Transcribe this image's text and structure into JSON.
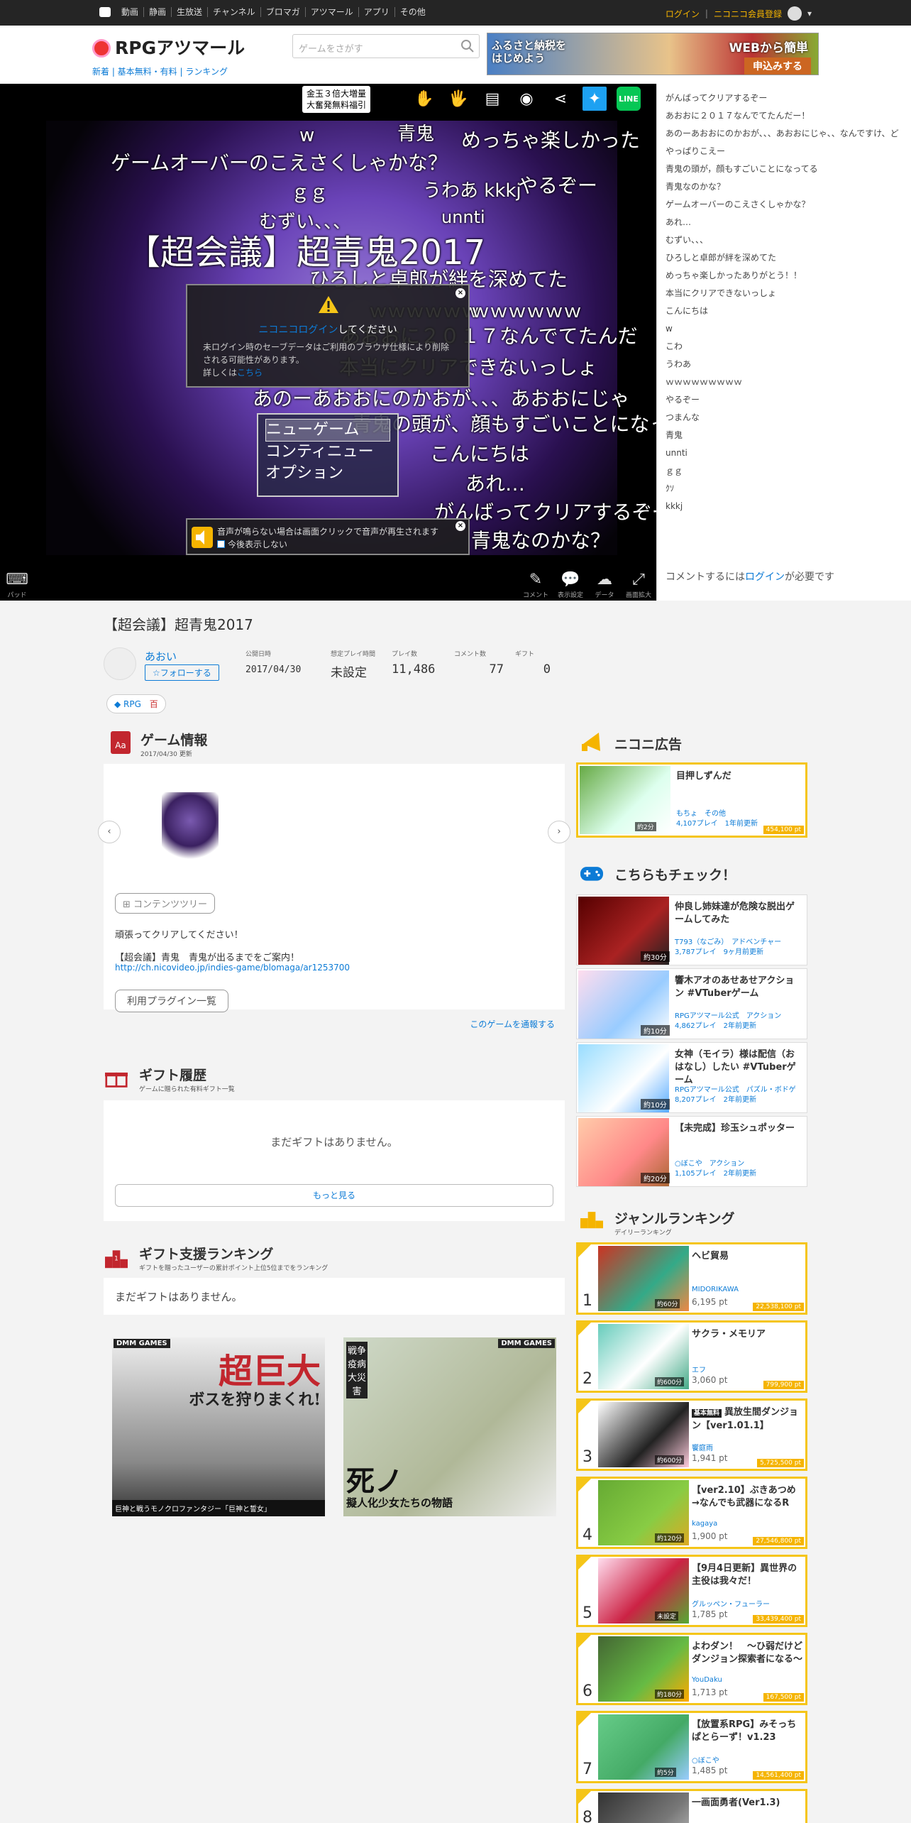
{
  "topbar": {
    "nav": [
      "動画",
      "静画",
      "生放送",
      "チャンネル",
      "ブロマガ",
      "アツマール",
      "アプリ",
      "その他"
    ],
    "login": "ログイン",
    "register": "ニコニコ会員登録"
  },
  "header": {
    "logo": "RPGアツマール",
    "sublinks": "新着 | 基本無料・有料 | ランキング",
    "search_placeholder": "ゲームをさがす",
    "ad_text1": "ふるさと納税を\nはじめよう",
    "ad_text2": "WEBから簡単",
    "ad_button": "申込みする"
  },
  "player": {
    "bubble": "金玉３倍大増量\n大奮発無料福引",
    "overlay": [
      {
        "t": "w",
        "l": 422,
        "tp": 176,
        "s": 26
      },
      {
        "t": "青鬼",
        "l": 560,
        "tp": 168,
        "s": 26
      },
      {
        "t": "めっちゃ楽しかった",
        "l": 650,
        "tp": 176,
        "s": 28
      },
      {
        "t": "ゲームオーバーのこえさくしゃかな？",
        "l": 156,
        "tp": 208,
        "s": 28
      },
      {
        "t": "ｇｇ",
        "l": 410,
        "tp": 250,
        "s": 26
      },
      {
        "t": "うわあ kkkj",
        "l": 596,
        "tp": 248,
        "s": 26
      },
      {
        "t": "やるぞー",
        "l": 730,
        "tp": 240,
        "s": 28
      },
      {
        "t": "むずい、、、",
        "l": 365,
        "tp": 292,
        "s": 26
      },
      {
        "t": "unnti",
        "l": 622,
        "tp": 292,
        "s": 24
      },
      {
        "t": "【超会議】超青鬼2017",
        "l": 178,
        "tp": 316,
        "s": 48
      },
      {
        "t": "ひろしと卓郎が絆を深めてた",
        "l": 436,
        "tp": 372,
        "s": 28
      },
      {
        "t": "ｗｗｗｗｗｗ",
        "l": 520,
        "tp": 418,
        "s": 26
      },
      {
        "t": "ｗｗｗｗｗｗ",
        "l": 664,
        "tp": 418,
        "s": 26
      },
      {
        "t": "あおおに２０１７なんでてたんだ",
        "l": 480,
        "tp": 452,
        "s": 28
      },
      {
        "t": "本当にクリアできないっしょ",
        "l": 478,
        "tp": 496,
        "s": 28
      },
      {
        "t": "あのーあおおにのかおが、、、あおおにじゃ",
        "l": 356,
        "tp": 540,
        "s": 28
      },
      {
        "t": "青鬼の頭が、顔もすごいことになってる",
        "l": 496,
        "tp": 576,
        "s": 28
      },
      {
        "t": "こんにちは",
        "l": 606,
        "tp": 618,
        "s": 28
      },
      {
        "t": "あれ…",
        "l": 656,
        "tp": 660,
        "s": 28
      },
      {
        "t": "がんばってクリアするぞー",
        "l": 612,
        "tp": 700,
        "s": 28
      },
      {
        "t": "青鬼なのかな？",
        "l": 664,
        "tp": 740,
        "s": 28
      }
    ],
    "login_title_link": "ニコニコログイン",
    "login_title_rest": "してください",
    "login_desc1": "未ログイン時のセーブデータはご利用のブラウザ仕様により削除される可能性があります。",
    "login_desc2": "詳しくは",
    "login_desc_link": "こちら",
    "menu": [
      "ニューゲーム",
      "コンティニュー",
      "オプション"
    ],
    "sound_text": "音声が鳴らない場合は画面クリックで音声が再生されます",
    "sound_check": "今後表示しない",
    "pad_label": "パッド",
    "bottom_tools": [
      "コメント",
      "表示設定",
      "データ",
      "画面拡大"
    ]
  },
  "comments": {
    "items": [
      "がんばってクリアするぞー",
      "あおおに２０１７なんでてたんだー！",
      "あのーあおおにのかおが、、、あおおにじゃ、、なんですけ、ど",
      "やっぱりこえー",
      "青鬼の頭が，顔もすごいことになってる",
      "青鬼なのかな？",
      "ゲームオーバーのこえさくしゃかな？",
      "あれ…",
      "むずい、、、",
      "ひろしと卓郎が絆を深めてた",
      "めっちゃ楽しかったありがとう！！",
      "本当にクリアできないっしょ",
      "こんにちは",
      "w",
      "こわ",
      "うわあ",
      "ｗｗｗｗｗｗｗｗｗ",
      "やるぞー",
      "つまんな",
      "青鬼",
      "unnti",
      "ｇｇ",
      "ｸｿ",
      "kkkj"
    ],
    "footer_prefix": "コメントするには",
    "footer_link": "ログイン",
    "footer_suffix": "が必要です"
  },
  "game": {
    "title": "【超会議】超青鬼2017",
    "author": "あおい",
    "follow": "☆フォローする",
    "stats": [
      {
        "label": "公開日時",
        "value": "2017/04/30"
      },
      {
        "label": "想定プレイ時間",
        "value": "未設定"
      },
      {
        "label": "プレイ数",
        "value": "11,486"
      },
      {
        "label": "コメント数",
        "value": "77"
      },
      {
        "label": "ギフト",
        "value": "0"
      }
    ],
    "tag": "RPG",
    "tag_badge": "百"
  },
  "info": {
    "heading": "ゲーム情報",
    "updated": "2017/04/30 更新",
    "tree_button": "コンテンツツリー",
    "desc1": "頑張ってクリアしてください！",
    "desc2": "【超会議】青鬼　青鬼が出るまでをご案内！",
    "link": "http://ch.nicovideo.jp/indies-game/blomaga/ar1253700",
    "plugin_button": "利用プラグイン一覧",
    "report": "このゲームを通報する"
  },
  "gift": {
    "heading": "ギフト履歴",
    "sub": "ゲームに贈られた有料ギフト一覧",
    "empty": "まだギフトはありません。",
    "more": "もっと見る"
  },
  "gift_rank": {
    "heading": "ギフト支援ランキング",
    "sub": "ギフトを贈ったユーザーの累計ポイント上位5位までをランキング",
    "empty": "まだギフトはありません。"
  },
  "banners": [
    {
      "title": "超巨大",
      "sub": "ボスを狩りまくれ!",
      "caption": "巨神と戦うモノクロファンタジー「巨神と誓女」",
      "brand": "DMM GAMES"
    },
    {
      "title": "死ノ",
      "sub": "擬人化少女たちの物語",
      "caption": "戦争 疫病 大災害",
      "brand": "DMM GAMES"
    }
  ],
  "nico_ad": {
    "heading": "ニコニ広告",
    "title": "目押しずんだ",
    "author": "もちょ　その他",
    "meta": "4,107プレイ　1年前更新",
    "pts": "454,100 pt",
    "dur": "約2分"
  },
  "check": {
    "heading": "こちらもチェック！",
    "items": [
      {
        "title": "仲良し姉妹達が危険な脱出ゲームしてみた",
        "author": "T793（なごみ）　アドベンチャー",
        "meta": "3,787プレイ　9ヶ月前更新",
        "dur": "約30分"
      },
      {
        "title": "響木アオのあせあせアクション #VTuberゲーム",
        "author": "RPGアツマール公式　アクション",
        "meta": "4,862プレイ　2年前更新",
        "dur": "約10分"
      },
      {
        "title": "女神（モイラ）様は配信（おはなし）したい #VTuberゲーム",
        "author": "RPGアツマール公式　パズル・ボドゲ",
        "meta": "8,207プレイ　2年前更新",
        "dur": "約10分"
      },
      {
        "title": "【未完成】珍玉シュポッター",
        "author": "○ぼこや　アクション",
        "meta": "1,105プレイ　2年前更新",
        "dur": "約20分"
      }
    ]
  },
  "ranking": {
    "heading": "ジャンルランキング",
    "sub": "デイリーランキング",
    "items": [
      {
        "rank": "1",
        "title": "ヘビ貿易",
        "author": "MIDORIKAWA",
        "plays": "6,195 pt",
        "pts": "22,538,100 pt",
        "dur": "約60分"
      },
      {
        "rank": "2",
        "title": "サクラ・メモリア",
        "author": "エフ",
        "plays": "3,060 pt",
        "pts": "799,900 pt",
        "dur": "約600分"
      },
      {
        "rank": "3",
        "title": "異放生間ダンジョン【ver1.01.1】",
        "author": "饗庭雨",
        "plays": "1,941 pt",
        "pts": "5,725,500 pt",
        "dur": "約600分",
        "badge": "基本無料"
      },
      {
        "rank": "4",
        "title": "【ver2.10】ぶきあつめ →なんでも武器になるR",
        "author": "kagaya",
        "plays": "1,900 pt",
        "pts": "27,546,800 pt",
        "dur": "約120分"
      },
      {
        "rank": "5",
        "title": "【9月4日更新】異世界の主役は我々だ！",
        "author": "グルッペン・フューラー",
        "plays": "1,785 pt",
        "pts": "33,439,400 pt",
        "dur": "未設定"
      },
      {
        "rank": "6",
        "title": "よわダン！　～ひ弱だけどダンジョン探索者になる～",
        "author": "YouDaku",
        "plays": "1,713 pt",
        "pts": "167,500 pt",
        "dur": "約180分"
      },
      {
        "rank": "7",
        "title": "【放置系RPG】みそっちぱとらーず！v1.23",
        "author": "○ぼこや",
        "plays": "1,485 pt",
        "pts": "14,561,400 pt",
        "dur": "約5分"
      },
      {
        "rank": "8",
        "title": "一画面勇者(Ver1.3)",
        "author": "",
        "plays": "",
        "pts": "",
        "dur": ""
      }
    ]
  },
  "colors": {
    "accent": "#0c7bd6",
    "gold": "#f5c518",
    "topbar": "#252525"
  }
}
